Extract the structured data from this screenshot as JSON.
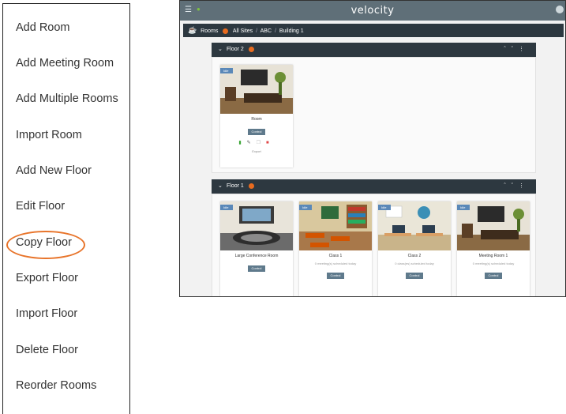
{
  "menu": {
    "items": [
      "Add Room",
      "Add Meeting Room",
      "Add Multiple Rooms",
      "Import Room",
      "Add New Floor",
      "Edit Floor",
      "Copy Floor",
      "Export Floor",
      "Import Floor",
      "Delete Floor",
      "Reorder Rooms"
    ],
    "highlighted": "Copy Floor",
    "highlight_color": "#e8742a"
  },
  "app": {
    "logo": "velocity",
    "menu_icon": "hamburger-icon",
    "topbar_color": "#5f6f78",
    "breadcrumb": {
      "title": "Rooms",
      "path": [
        "All Sites",
        "ABC",
        "Building 1"
      ],
      "separator": "/"
    },
    "floors": [
      {
        "name": "Floor 2",
        "rooms": [
          {
            "badge": "Idle",
            "name": "Room",
            "subtitle": "",
            "control": "Control",
            "export": "Export"
          }
        ]
      },
      {
        "name": "Floor 1",
        "rooms": [
          {
            "badge": "Idle",
            "name": "Large Conference Room",
            "subtitle": "",
            "control": "Control"
          },
          {
            "badge": "Idle",
            "name": "Class 1",
            "subtitle": "0 meeting(s) scheduled today",
            "control": "Control"
          },
          {
            "badge": "Idle",
            "name": "Class 2",
            "subtitle": "0 class(es) scheduled today",
            "control": "Control"
          },
          {
            "badge": "Idle",
            "name": "Meeting Room 1",
            "subtitle": "0 meeting(s) scheduled today",
            "control": "Control"
          }
        ]
      }
    ]
  }
}
